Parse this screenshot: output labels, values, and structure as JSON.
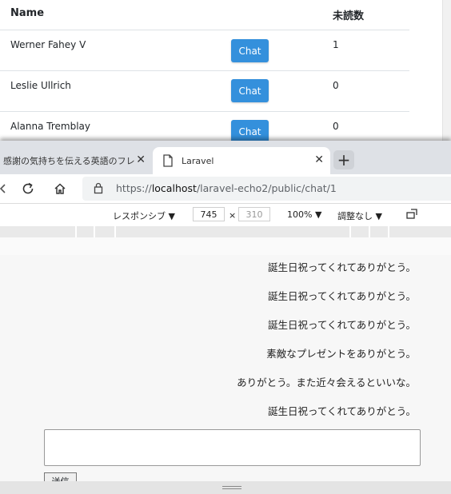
{
  "table": {
    "headers": {
      "name": "Name",
      "unread": "未読数"
    },
    "rows": [
      {
        "name": "Werner Fahey V",
        "button": "Chat",
        "unread": "1"
      },
      {
        "name": "Leslie Ullrich",
        "button": "Chat",
        "unread": "0"
      },
      {
        "name": "Alanna Tremblay",
        "button": "Chat",
        "unread": "0"
      }
    ]
  },
  "browser": {
    "tabs": [
      {
        "title": "感謝の気持ちを伝える英語のフレーズ",
        "active": false
      },
      {
        "title": "Laravel",
        "active": true
      }
    ],
    "url_prefix": "https://",
    "url_host": "localhost",
    "url_path": "/laravel-echo2/public/chat/1",
    "devtools": {
      "responsive_label": "レスポンシブ",
      "width": "745",
      "height_placeholder": "310",
      "times": "×",
      "zoom": "100%",
      "throttle": "調整なし"
    }
  },
  "chat": {
    "messages": [
      "誕生日祝ってくれてありがとう。",
      "誕生日祝ってくれてありがとう。",
      "誕生日祝ってくれてありがとう。",
      "素敵なプレゼントをありがとう。",
      "ありがとう。また近々会えるといいな。",
      "誕生日祝ってくれてありがとう。"
    ],
    "send_label": "送信"
  },
  "colors": {
    "chat_button": "#3490dc",
    "tab_strip": "#dee1e6"
  }
}
